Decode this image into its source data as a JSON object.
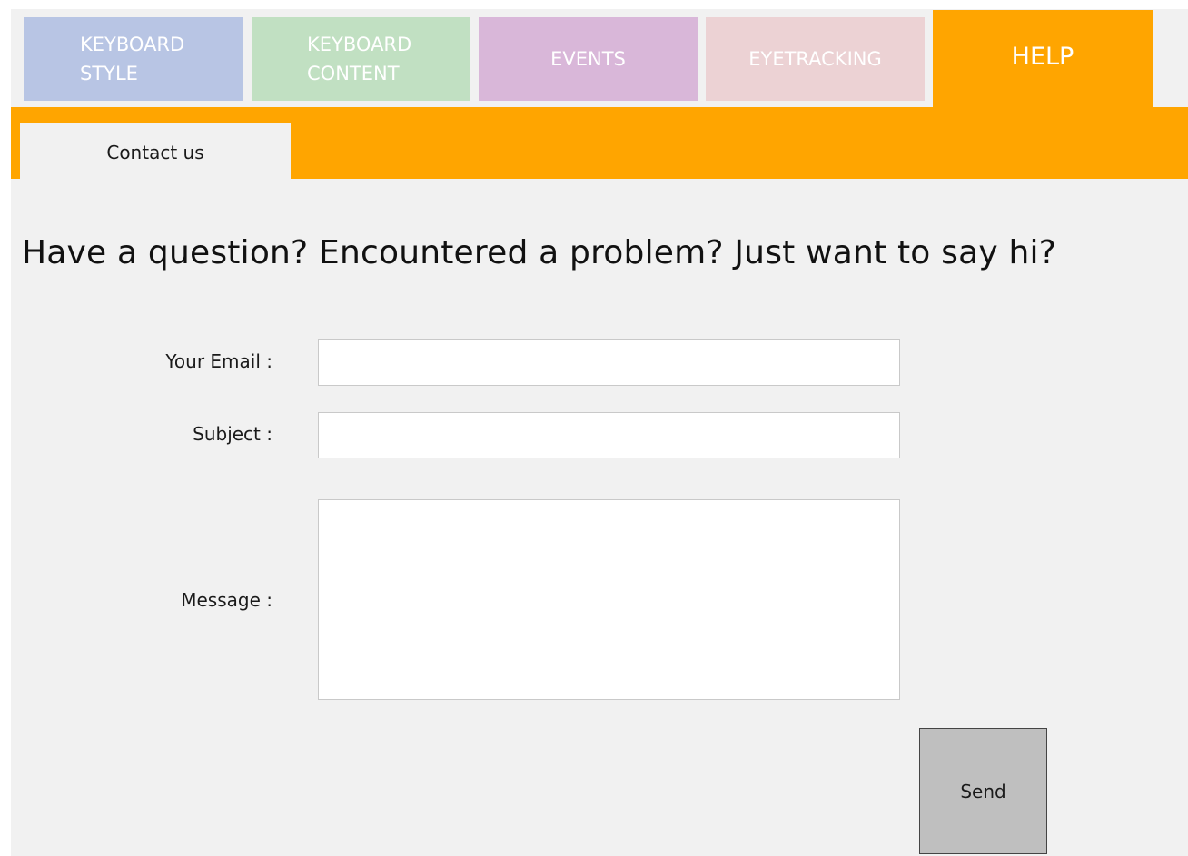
{
  "tabs": {
    "keyboard_style": "KEYBOARD\nSTYLE",
    "keyboard_content": "KEYBOARD\nCONTENT",
    "events": "EVENTS",
    "eyetracking": "EYETRACKING",
    "help": "HELP"
  },
  "subtabs": {
    "contact_us": "Contact us"
  },
  "main": {
    "heading": "Have a question? Encountered a problem? Just want to say hi?",
    "form": {
      "email_label": "Your Email :",
      "email_value": "",
      "subject_label": "Subject :",
      "subject_value": "",
      "message_label": "Message :",
      "message_value": "",
      "send_label": "Send"
    }
  },
  "colors": {
    "keyboard_style_tab": "#b8c5e4",
    "keyboard_content_tab": "#c1e0c2",
    "events_tab": "#d9b7d9",
    "eyetracking_tab": "#ecd2d4",
    "help_tab_active": "#ffa500",
    "background": "#f1f1f1",
    "send_button": "#bfbfbf"
  }
}
